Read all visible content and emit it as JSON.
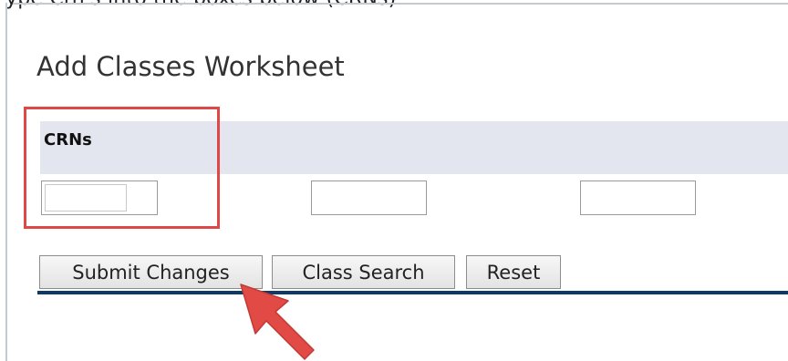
{
  "top_cut_text": "ype Crn's into the boxes below (CRNs)",
  "page": {
    "title": "Add Classes Worksheet"
  },
  "crn_section": {
    "header": "CRNs",
    "inputs": [
      {
        "value": "",
        "placeholder": ""
      },
      {
        "value": "",
        "placeholder": ""
      },
      {
        "value": "",
        "placeholder": ""
      }
    ]
  },
  "buttons": {
    "submit": "Submit Changes",
    "class_search": "Class Search",
    "reset": "Reset"
  },
  "annotations": {
    "highlight_color": "#e04848",
    "arrow_color": "#e24a45"
  },
  "colors": {
    "header_band": "#e3e6ef",
    "rule": "#0d3a68"
  }
}
